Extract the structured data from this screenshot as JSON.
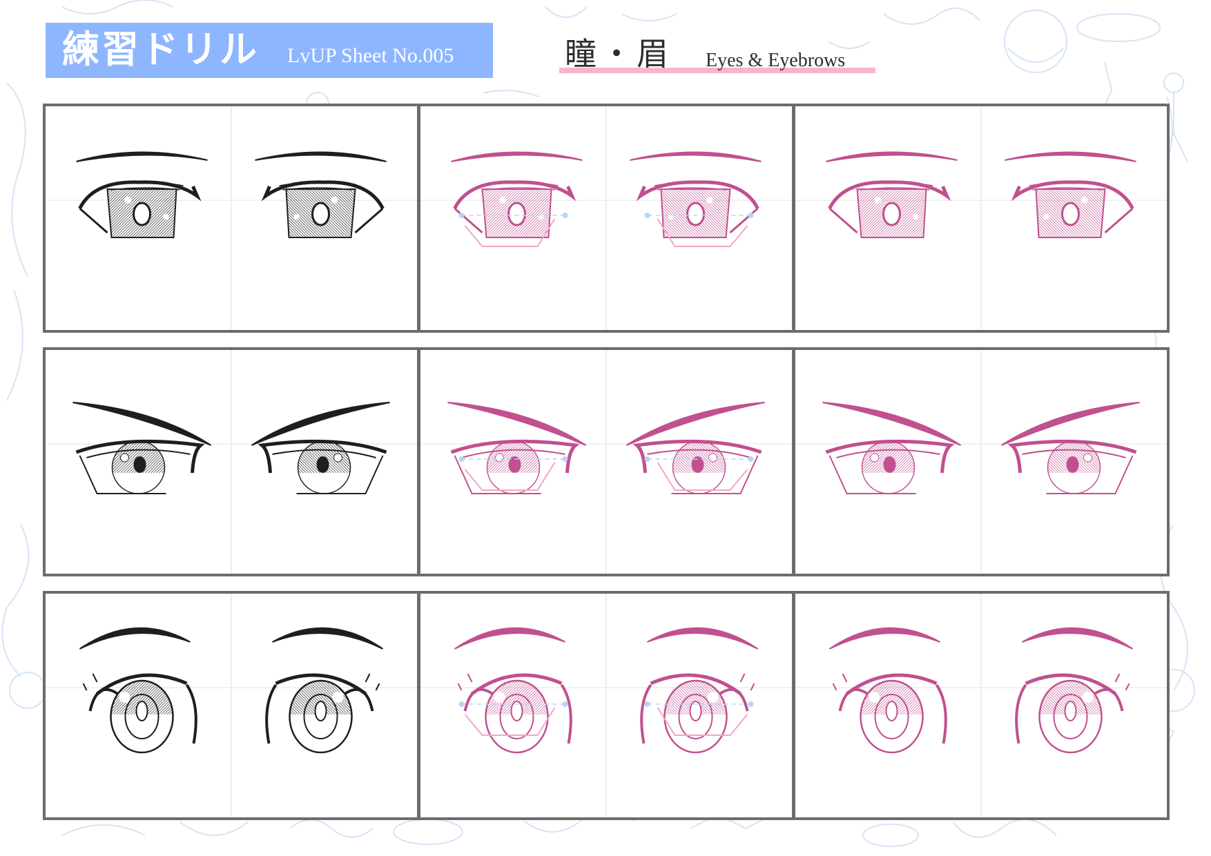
{
  "header": {
    "title": "練習ドリル",
    "sheet_label": "LvUP Sheet No.005",
    "subject_jp": "瞳・眉",
    "subject_en": "Eyes & Eyebrows"
  },
  "colors": {
    "title_bg": "#8db6ff",
    "underline": "#f6b6c8",
    "panel_border": "#6c6c6c",
    "ink": "#1e1e1e",
    "pink_ink": "#c0508f",
    "guide_pink": "#f2a6c0",
    "guide_blue": "#b9d4f5",
    "background_doodles": "#d6e4f7"
  },
  "rows": [
    {
      "name": "row-1",
      "eye_style": "large-rounded",
      "panels": [
        {
          "name": "row1-ink-example",
          "ink": "black"
        },
        {
          "name": "row1-pink-guide",
          "ink": "pink"
        },
        {
          "name": "row1-pink-trace",
          "ink": "pink"
        }
      ]
    },
    {
      "name": "row-2",
      "eye_style": "sharp-narrow",
      "panels": [
        {
          "name": "row2-ink-example",
          "ink": "black"
        },
        {
          "name": "row2-pink-guide",
          "ink": "pink"
        },
        {
          "name": "row2-pink-trace",
          "ink": "pink"
        }
      ]
    },
    {
      "name": "row-3",
      "eye_style": "round-cute",
      "panels": [
        {
          "name": "row3-ink-example",
          "ink": "black"
        },
        {
          "name": "row3-pink-guide",
          "ink": "pink"
        },
        {
          "name": "row3-pink-trace",
          "ink": "pink"
        }
      ]
    }
  ]
}
